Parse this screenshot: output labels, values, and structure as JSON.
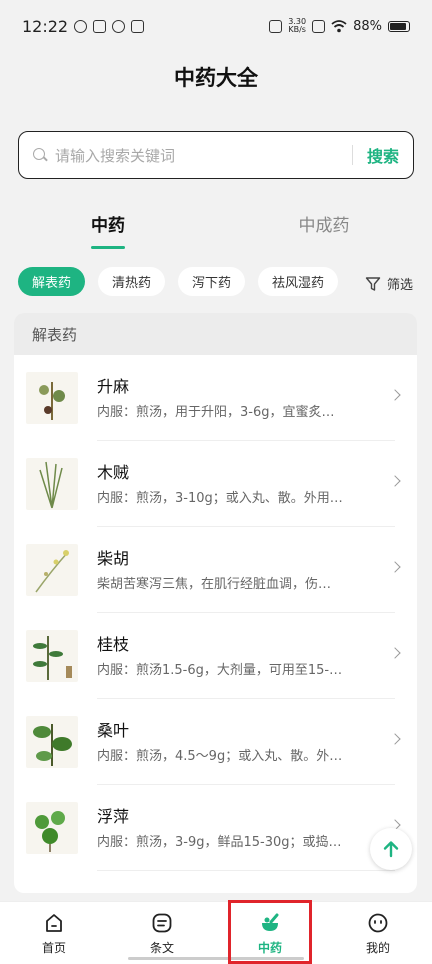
{
  "status": {
    "time": "12:22",
    "net_speed_top": "3.30",
    "net_speed_bottom": "KB/s",
    "battery": "88%"
  },
  "header": {
    "title": "中药大全"
  },
  "search": {
    "placeholder": "请输入搜索关键词",
    "button": "搜索"
  },
  "tabs": [
    {
      "label": "中药"
    },
    {
      "label": "中成药"
    }
  ],
  "chips": [
    {
      "label": "解表药"
    },
    {
      "label": "清热药"
    },
    {
      "label": "泻下药"
    },
    {
      "label": "祛风湿药"
    }
  ],
  "filter_label": "筛选",
  "section": {
    "title": "解表药"
  },
  "items": [
    {
      "name": "升麻",
      "desc": "内服：煎汤，用于升阳，3-6g，宜蜜炙…"
    },
    {
      "name": "木贼",
      "desc": "内服：煎汤，3-10g；或入丸、散。外用…"
    },
    {
      "name": "柴胡",
      "desc": "柴胡苦寒泻三焦，在肌行经脏血调，伤…"
    },
    {
      "name": "桂枝",
      "desc": "内服：煎汤1.5-6g，大剂量，可用至15-…"
    },
    {
      "name": "桑叶",
      "desc": "内服：煎汤，4.5～9g；或入丸、散。外…"
    },
    {
      "name": "浮萍",
      "desc": "内服：煎汤，3-9g，鲜品15-30g；或捣…"
    }
  ],
  "nav": [
    {
      "label": "首页"
    },
    {
      "label": "条文"
    },
    {
      "label": "中药"
    },
    {
      "label": "我的"
    }
  ],
  "colors": {
    "accent": "#1eb482",
    "highlight": "#e0242b"
  }
}
